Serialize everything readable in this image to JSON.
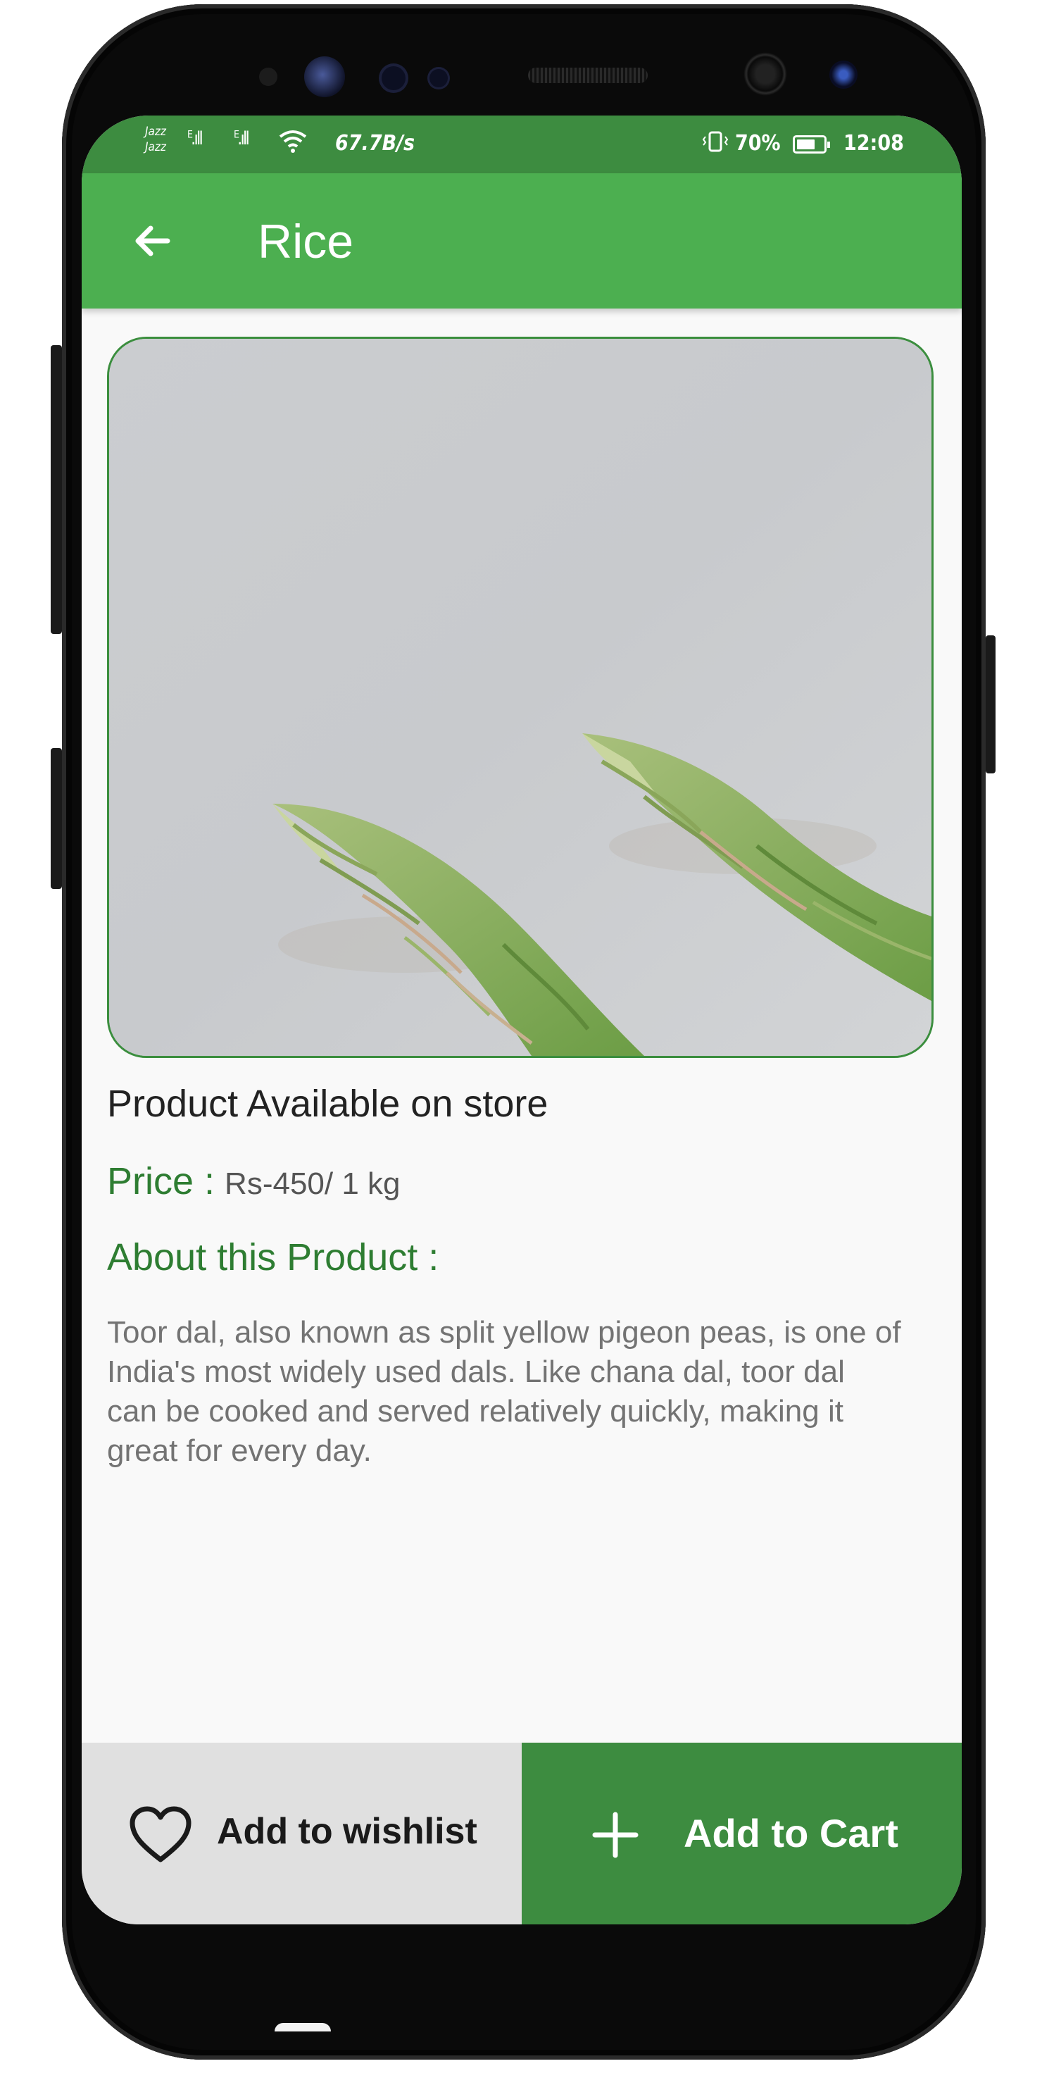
{
  "status_bar": {
    "carrier_1": "Jazz",
    "carrier_2": "Jazz",
    "network_1": "E",
    "network_2": "E",
    "net_speed": "67.7B/s",
    "battery_percent": "70%",
    "battery_level": 0.7,
    "time": "12:08"
  },
  "app_bar": {
    "back_icon": "arrow-left-icon",
    "title": "Rice"
  },
  "product": {
    "image": "asparagus-photo",
    "availability": "Product Available on store",
    "price_label": "Price :",
    "price_value": "Rs-450/ 1 kg",
    "about_heading": "About this Product :",
    "description": "Toor dal, also known as split yellow pigeon peas, is one of India's most widely used dals. Like chana dal, toor dal can be cooked and served relatively quickly, making it great for every day."
  },
  "actions": {
    "wishlist_icon": "heart-outline-icon",
    "wishlist_label": "Add to wishlist",
    "cart_icon": "plus-icon",
    "cart_label": "Add to Cart"
  },
  "colors": {
    "primary": "#4caf50",
    "primary_dark": "#3d8c40",
    "heading_green": "#2e7d32",
    "wishlist_bg": "#e0e0e0"
  }
}
